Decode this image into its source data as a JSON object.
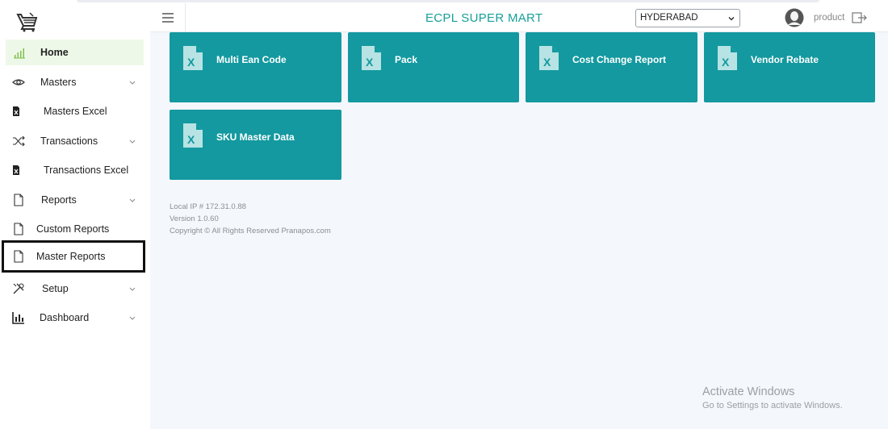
{
  "app": {
    "title": "ECPL SUPER MART"
  },
  "header": {
    "branch_selected": "HYDERABAD",
    "user_name": "product"
  },
  "sidebar": {
    "items": [
      {
        "label": "Home",
        "icon": "bar-chart-icon",
        "expandable": false,
        "active": true
      },
      {
        "label": "Masters",
        "icon": "eye-icon",
        "expandable": true
      },
      {
        "label": "Masters Excel",
        "icon": "excel-file-icon",
        "expandable": false
      },
      {
        "label": "Transactions",
        "icon": "shuffle-icon",
        "expandable": true
      },
      {
        "label": "Transactions Excel",
        "icon": "excel-file-icon",
        "expandable": false
      },
      {
        "label": "Reports",
        "icon": "document-icon",
        "expandable": true
      },
      {
        "label": "Custom Reports",
        "icon": "document-icon",
        "expandable": false
      },
      {
        "label": "Master Reports",
        "icon": "document-icon",
        "expandable": false,
        "highlighted": true
      },
      {
        "label": "Setup",
        "icon": "tools-icon",
        "expandable": true
      },
      {
        "label": "Dashboard",
        "icon": "chart-icon",
        "expandable": true
      }
    ]
  },
  "tiles": [
    {
      "label": "Multi Ean Code"
    },
    {
      "label": "Pack"
    },
    {
      "label": "Cost Change Report"
    },
    {
      "label": "Vendor Rebate"
    },
    {
      "label": "SKU Master Data"
    }
  ],
  "footer": {
    "ip": "Local IP # 172.31.0.88",
    "version": "Version 1.0.60",
    "copyright": "Copyright © All Rights Reserved Pranapos.com"
  },
  "watermark": {
    "line1": "Activate Windows",
    "line2": "Go to Settings to activate Windows."
  },
  "colors": {
    "accent": "#13999f",
    "title": "#17a09a",
    "active_bg": "#eef8e8"
  }
}
